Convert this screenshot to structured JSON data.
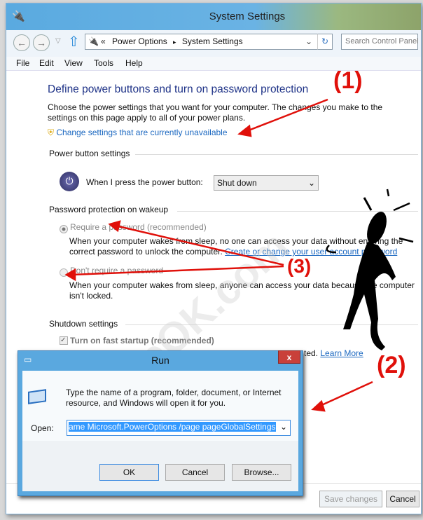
{
  "window": {
    "title": "System Settings"
  },
  "nav": {
    "back": "←",
    "forward": "→",
    "dropdown": "▽",
    "up": "⇧",
    "breadcrumb_prefix": "«",
    "breadcrumb": [
      "Power Options",
      "System Settings"
    ],
    "separator": "▸",
    "address_dropdown": "⌄",
    "refresh": "↻",
    "search_placeholder": "Search Control Panel"
  },
  "menu": [
    "File",
    "Edit",
    "View",
    "Tools",
    "Help"
  ],
  "main": {
    "heading": "Define power buttons and turn on password protection",
    "desc1": "Choose the power settings that you want for your computer. The changes you make to the settings on this",
    "desc2": "page apply to all of your power plans.",
    "change_link": "Change settings that are currently unavailable",
    "power_section": "Power button settings",
    "power_label": "When I press the power button:",
    "power_value": "Shut down",
    "password_section": "Password protection on wakeup",
    "require_label": "Require a password (recommended)",
    "require_desc1": "When your computer wakes from sleep, no one can access your data without entering the correct",
    "require_desc2": "password to unlock the computer.",
    "require_link": "Create or change your user account password",
    "norequire_label": "Don't require a password",
    "norequire_desc1": "When your computer wakes from sleep, anyone can access your data because the computer isn't",
    "norequire_desc2": "locked.",
    "shutdown_section": "Shutdown settings",
    "fast_startup": "Turn on fast startup (recommended)",
    "fast_desc_tail": "ted.",
    "learn_more": "Learn More",
    "save": "Save changes",
    "cancel": "Cancel"
  },
  "run": {
    "title": "Run",
    "close": "x",
    "desc1": "Type the name of a program, folder, document, or Internet",
    "desc2": "resource, and Windows will open it for you.",
    "open_label": "Open:",
    "open_value": "ame Microsoft.PowerOptions /page pageGlobalSettings",
    "ok": "OK",
    "cancel": "Cancel",
    "browse": "Browse..."
  },
  "annotations": {
    "a1": "(1)",
    "a2": "(2)",
    "a3": "(3)",
    "color": "#e0100a"
  },
  "watermark": "SoftwareOK.com"
}
